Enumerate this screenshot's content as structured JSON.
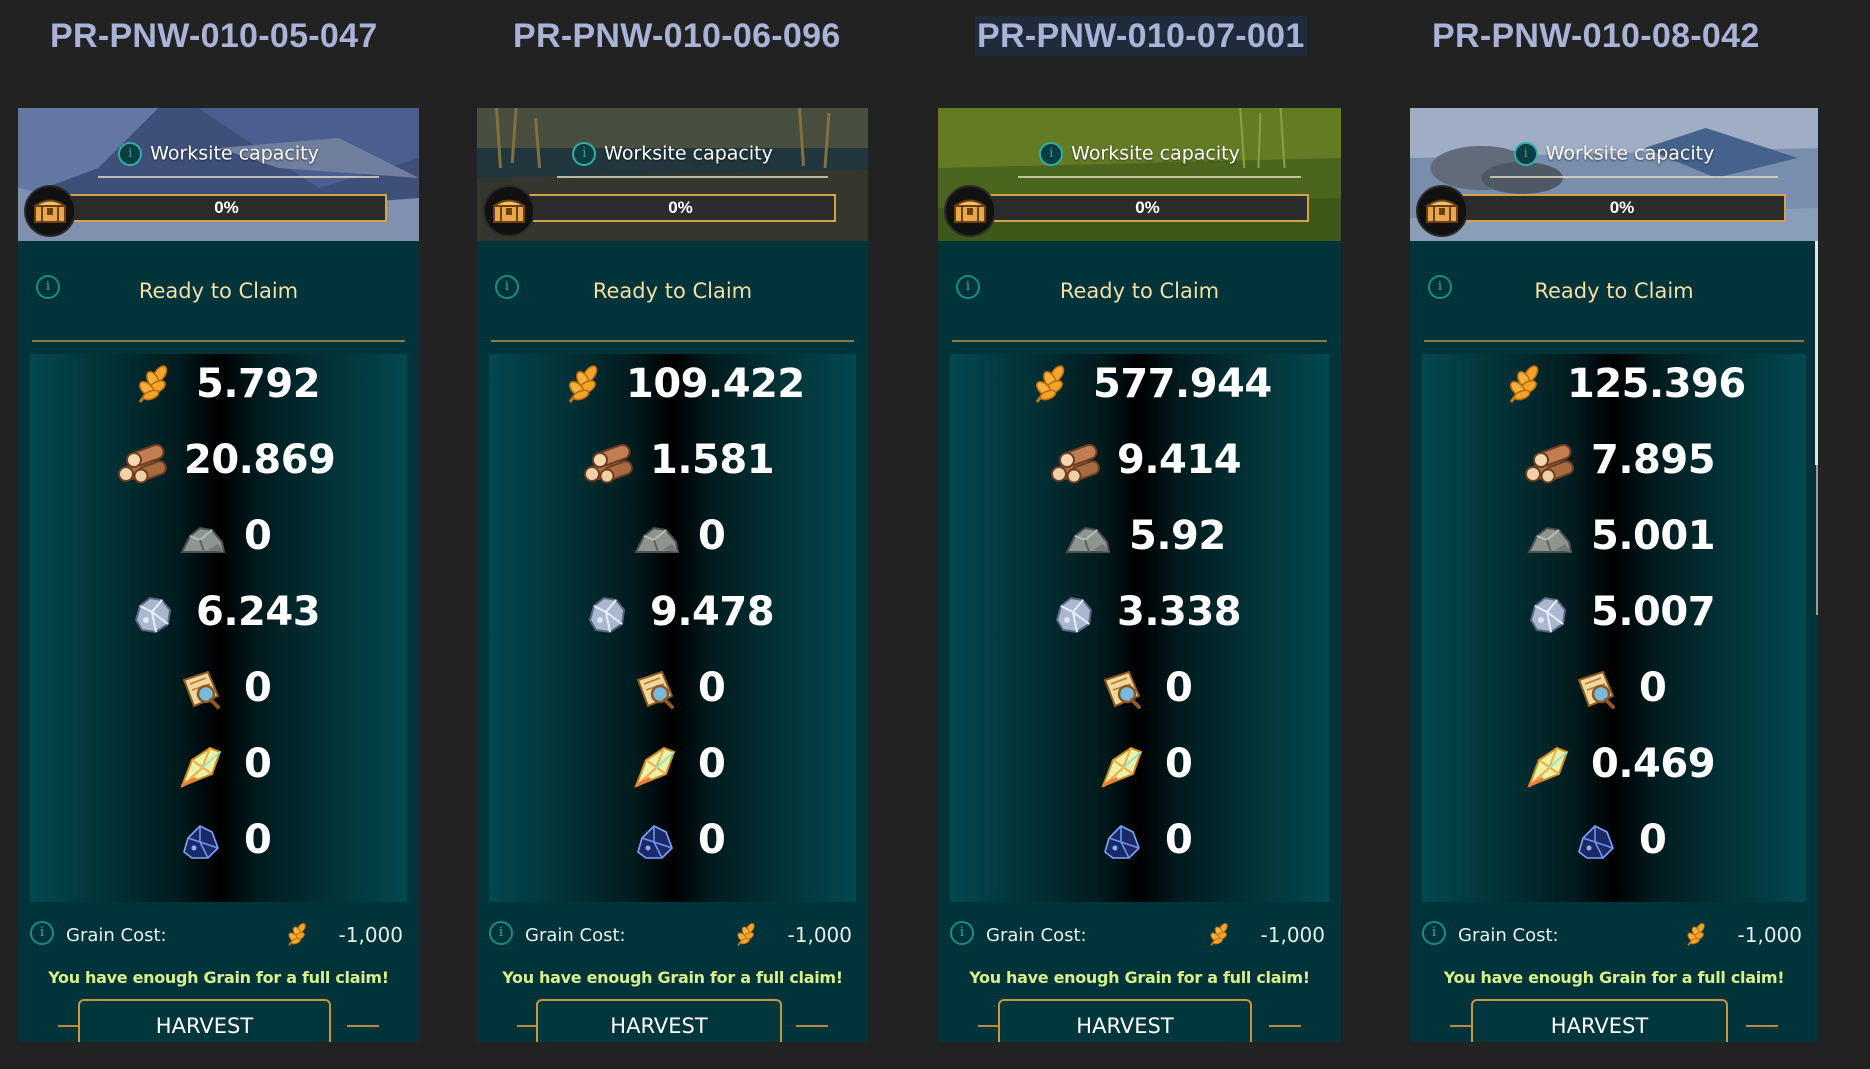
{
  "worksites": [
    {
      "id": "PR-PNW-010-05-047",
      "selected": false,
      "header_theme": "blue-snow",
      "capacity_label": "Worksite capacity",
      "capacity_percent": "0%",
      "capacity_fraction": 0,
      "ready_label": "Ready to Claim",
      "resources": [
        {
          "icon": "grain-icon",
          "value": "5.792"
        },
        {
          "icon": "wood-icon",
          "value": "20.869"
        },
        {
          "icon": "stone-icon",
          "value": "0"
        },
        {
          "icon": "iron-ore-icon",
          "value": "6.243"
        },
        {
          "icon": "scroll-map-icon",
          "value": "0"
        },
        {
          "icon": "crystal-icon",
          "value": "0"
        },
        {
          "icon": "dark-ore-icon",
          "value": "0"
        }
      ],
      "grain_cost_label": "Grain Cost:",
      "grain_cost_value": "-1,000",
      "notice": "You have enough Grain for a full claim!",
      "harvest_label": "HARVEST"
    },
    {
      "id": "PR-PNW-010-06-096",
      "selected": false,
      "header_theme": "reed-marsh",
      "capacity_label": "Worksite capacity",
      "capacity_percent": "0%",
      "capacity_fraction": 0,
      "ready_label": "Ready to Claim",
      "resources": [
        {
          "icon": "grain-icon",
          "value": "109.422"
        },
        {
          "icon": "wood-icon",
          "value": "1.581"
        },
        {
          "icon": "stone-icon",
          "value": "0"
        },
        {
          "icon": "iron-ore-icon",
          "value": "9.478"
        },
        {
          "icon": "scroll-map-icon",
          "value": "0"
        },
        {
          "icon": "crystal-icon",
          "value": "0"
        },
        {
          "icon": "dark-ore-icon",
          "value": "0"
        }
      ],
      "grain_cost_label": "Grain Cost:",
      "grain_cost_value": "-1,000",
      "notice": "You have enough Grain for a full claim!",
      "harvest_label": "HARVEST"
    },
    {
      "id": "PR-PNW-010-07-001",
      "selected": true,
      "header_theme": "green-meadow",
      "capacity_label": "Worksite capacity",
      "capacity_percent": "0%",
      "capacity_fraction": 0,
      "ready_label": "Ready to Claim",
      "resources": [
        {
          "icon": "grain-icon",
          "value": "577.944"
        },
        {
          "icon": "wood-icon",
          "value": "9.414"
        },
        {
          "icon": "stone-icon",
          "value": "5.92"
        },
        {
          "icon": "iron-ore-icon",
          "value": "3.338"
        },
        {
          "icon": "scroll-map-icon",
          "value": "0"
        },
        {
          "icon": "crystal-icon",
          "value": "0"
        },
        {
          "icon": "dark-ore-icon",
          "value": "0"
        }
      ],
      "grain_cost_label": "Grain Cost:",
      "grain_cost_value": "-1,000",
      "notice": "You have enough Grain for a full claim!",
      "harvest_label": "HARVEST"
    },
    {
      "id": "PR-PNW-010-08-042",
      "selected": false,
      "header_theme": "rocky-shore",
      "capacity_label": "Worksite capacity",
      "capacity_percent": "0%",
      "capacity_fraction": 0,
      "ready_label": "Ready to Claim",
      "resources": [
        {
          "icon": "grain-icon",
          "value": "125.396"
        },
        {
          "icon": "wood-icon",
          "value": "7.895"
        },
        {
          "icon": "stone-icon",
          "value": "5.001"
        },
        {
          "icon": "iron-ore-icon",
          "value": "5.007"
        },
        {
          "icon": "scroll-map-icon",
          "value": "0"
        },
        {
          "icon": "crystal-icon",
          "value": "0.469"
        },
        {
          "icon": "dark-ore-icon",
          "value": "0"
        }
      ],
      "grain_cost_label": "Grain Cost:",
      "grain_cost_value": "-1,000",
      "notice": "You have enough Grain for a full claim!",
      "harvest_label": "HARVEST"
    }
  ],
  "colors": {
    "page_bg": "#222222",
    "title": "#a9b3d8",
    "card_bg": "#00343a",
    "gold": "#d4a24c",
    "ready_text": "#f3dfa8",
    "notice_text": "#d8ef8a"
  }
}
